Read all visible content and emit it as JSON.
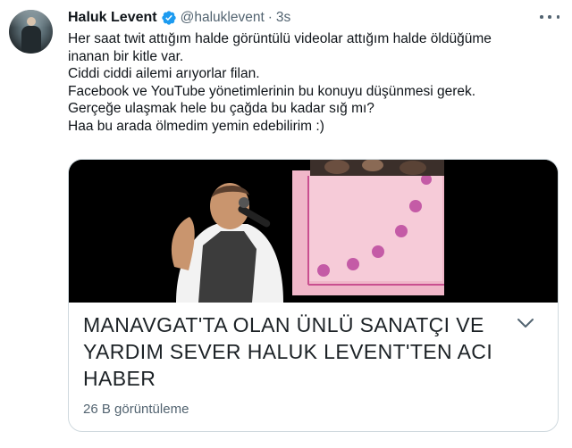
{
  "author": {
    "name": "Haluk Levent",
    "handle": "@haluklevent",
    "separator": "·",
    "time": "3s"
  },
  "icons": {
    "verified": "verified-badge-icon",
    "more": "more-icon",
    "expand": "chevron-down-icon"
  },
  "tweet": {
    "lines": [
      "Her saat twit attığım halde görüntülü videolar attığım halde öldüğüme",
      "inanan bir kitle var.",
      "Ciddi ciddi ailemi arıyorlar filan.",
      "Facebook ve YouTube yönetimlerinin bu konuyu düşünmesi gerek.",
      "Gerçeğe ulaşmak hele bu çağda bu kadar sığ mı?",
      "Haa bu arada ölmedim yemin edebilirim :)"
    ]
  },
  "card": {
    "headline_lines": [
      "MANAVGAT'TA OLAN ÜNLÜ SANATÇI VE",
      "YARDIM SEVER HALUK LEVENT'TEN ACI",
      "HABER"
    ],
    "views": "26 B görüntüleme"
  },
  "colors": {
    "verified": "#1d9bf0",
    "text": "#0f1419",
    "muted": "#536471",
    "border": "#cfd9de",
    "media_pink": "#f0b7c9",
    "media_dots": "#c45ba6"
  }
}
